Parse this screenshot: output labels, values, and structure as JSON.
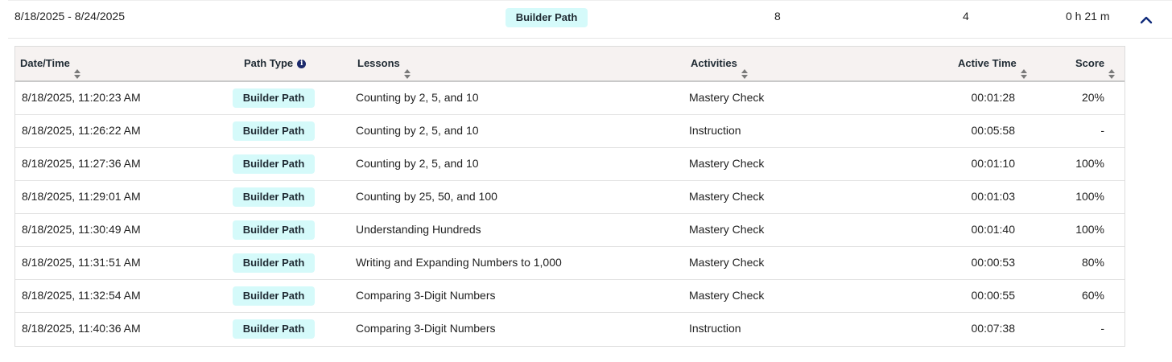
{
  "summary": {
    "date_range": "8/18/2025 - 8/24/2025",
    "path_type": "Builder Path",
    "lessons": "8",
    "activities": "4",
    "active_time": "0 h 21 m",
    "toggle_icon": "chevron-up-icon",
    "accent_color": "#0f2a7a"
  },
  "table": {
    "headers": {
      "date": "Date/Time",
      "path_type": "Path Type",
      "lessons": "Lessons",
      "activities": "Activities",
      "active_time": "Active Time",
      "score": "Score"
    },
    "badge_color": "#d5fafa",
    "rows": [
      {
        "date": "8/18/2025, 11:20:23 AM",
        "path_type": "Builder Path",
        "lesson": "Counting by 2, 5, and 10",
        "activity": "Mastery Check",
        "time": "00:01:28",
        "score": "20%"
      },
      {
        "date": "8/18/2025, 11:26:22 AM",
        "path_type": "Builder Path",
        "lesson": "Counting by 2, 5, and 10",
        "activity": "Instruction",
        "time": "00:05:58",
        "score": "-"
      },
      {
        "date": "8/18/2025, 11:27:36 AM",
        "path_type": "Builder Path",
        "lesson": "Counting by 2, 5, and 10",
        "activity": "Mastery Check",
        "time": "00:01:10",
        "score": "100%"
      },
      {
        "date": "8/18/2025, 11:29:01 AM",
        "path_type": "Builder Path",
        "lesson": "Counting by 25, 50, and 100",
        "activity": "Mastery Check",
        "time": "00:01:03",
        "score": "100%"
      },
      {
        "date": "8/18/2025, 11:30:49 AM",
        "path_type": "Builder Path",
        "lesson": "Understanding Hundreds",
        "activity": "Mastery Check",
        "time": "00:01:40",
        "score": "100%"
      },
      {
        "date": "8/18/2025, 11:31:51 AM",
        "path_type": "Builder Path",
        "lesson": "Writing and Expanding Numbers to 1,000",
        "activity": "Mastery Check",
        "time": "00:00:53",
        "score": "80%"
      },
      {
        "date": "8/18/2025, 11:32:54 AM",
        "path_type": "Builder Path",
        "lesson": "Comparing 3-Digit Numbers",
        "activity": "Mastery Check",
        "time": "00:00:55",
        "score": "60%"
      },
      {
        "date": "8/18/2025, 11:40:36 AM",
        "path_type": "Builder Path",
        "lesson": "Comparing 3-Digit Numbers",
        "activity": "Instruction",
        "time": "00:07:38",
        "score": "-"
      }
    ]
  }
}
